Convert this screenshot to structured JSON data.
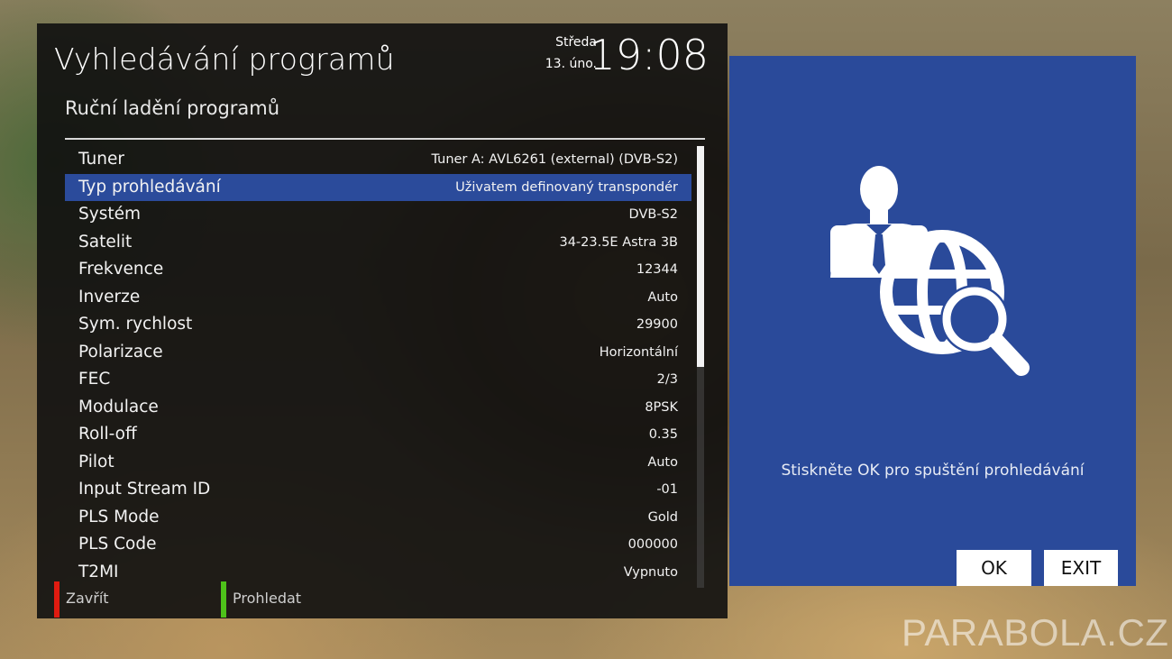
{
  "header": {
    "title": "Vyhledávání programů",
    "day": "Středa",
    "date": "13. úno.",
    "time": "19:08",
    "subtitle": "Ruční ladění programů"
  },
  "settings": [
    {
      "label": "Tuner",
      "value": "Tuner A: AVL6261 (external) (DVB-S2)",
      "selected": false
    },
    {
      "label": "Typ prohledávání",
      "value": "Uživatem definovaný transpondér",
      "selected": true
    },
    {
      "label": "Systém",
      "value": "DVB-S2",
      "selected": false
    },
    {
      "label": "Satelit",
      "value": "34-23.5E Astra 3B",
      "selected": false
    },
    {
      "label": "Frekvence",
      "value": "12344",
      "selected": false
    },
    {
      "label": "Inverze",
      "value": "Auto",
      "selected": false
    },
    {
      "label": "Sym. rychlost",
      "value": "29900",
      "selected": false
    },
    {
      "label": "Polarizace",
      "value": "Horizontální",
      "selected": false
    },
    {
      "label": "FEC",
      "value": "2/3",
      "selected": false
    },
    {
      "label": "Modulace",
      "value": "8PSK",
      "selected": false
    },
    {
      "label": "Roll-off",
      "value": "0.35",
      "selected": false
    },
    {
      "label": "Pilot",
      "value": "Auto",
      "selected": false
    },
    {
      "label": "Input Stream ID",
      "value": "-01",
      "selected": false
    },
    {
      "label": "PLS Mode",
      "value": "Gold",
      "selected": false
    },
    {
      "label": "PLS Code",
      "value": "000000",
      "selected": false
    },
    {
      "label": "T2MI",
      "value": "Vypnuto",
      "selected": false
    }
  ],
  "scroll": {
    "visible_fraction": 0.5
  },
  "color_keys": [
    {
      "label": "Zavřít",
      "color": "#e01b10"
    },
    {
      "label": "Prohledat",
      "color": "#4ec21a"
    }
  ],
  "side_panel": {
    "icon": "user-globe-search-icon",
    "hint": "Stiskněte OK pro spuštění prohledávání",
    "ok_label": "OK",
    "exit_label": "EXIT",
    "color": "#2a4a9a"
  },
  "watermark": "PARABOLA.CZ"
}
